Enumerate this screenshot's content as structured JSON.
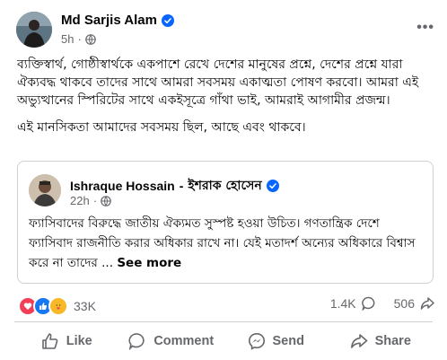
{
  "post": {
    "author": "Md Sarjis Alam",
    "time": "5h",
    "paragraphs": [
      "ব্যক্তিস্বার্থ, গোষ্ঠীস্বার্থকে একপাশে রেখে দেশের মানুষের প্রশ্নে, দেশের প্রশ্নে যারা ঐক্যবদ্ধ থাকবে তাদের সাথে আমরা সবসময় একাত্মতা পোষণ করবো। আমরা এই অভ্যুত্থানের স্পিরিটের সাথে একইসূত্রে গাঁথা ভাই, আমরাই আগামীর প্রজন্ম।",
      "এই মানসিকতা আমাদের সবসময় ছিল, আছে এবং থাকবে।"
    ]
  },
  "shared": {
    "author": "Ishraque Hossain",
    "separator": "-",
    "author_bn": "ইশরাক হোসেন",
    "time": "22h",
    "text": "ফ্যাসিবাদের বিরুদ্ধে জাতীয় ঐক্যমত সুস্পষ্ট হওয়া উচিত। গণতান্ত্রিক দেশে ফ্যাসিবাদ রাজনীতি করার অধিকার রাখে না। যেই মতাদর্শ অন্যের অধিকারে বিশ্বাস করে না তাদের ...",
    "see_more": "See more"
  },
  "reactions": {
    "count": "33K",
    "comments": "1.4K",
    "shares": "506",
    "icons": [
      "love-icon",
      "like-icon",
      "care-icon"
    ]
  },
  "actions": {
    "like": "Like",
    "comment": "Comment",
    "send": "Send",
    "share": "Share"
  },
  "colors": {
    "verified": "#0866ff",
    "text": "#050505",
    "muted": "#65676b",
    "divider": "#ced0d4"
  }
}
